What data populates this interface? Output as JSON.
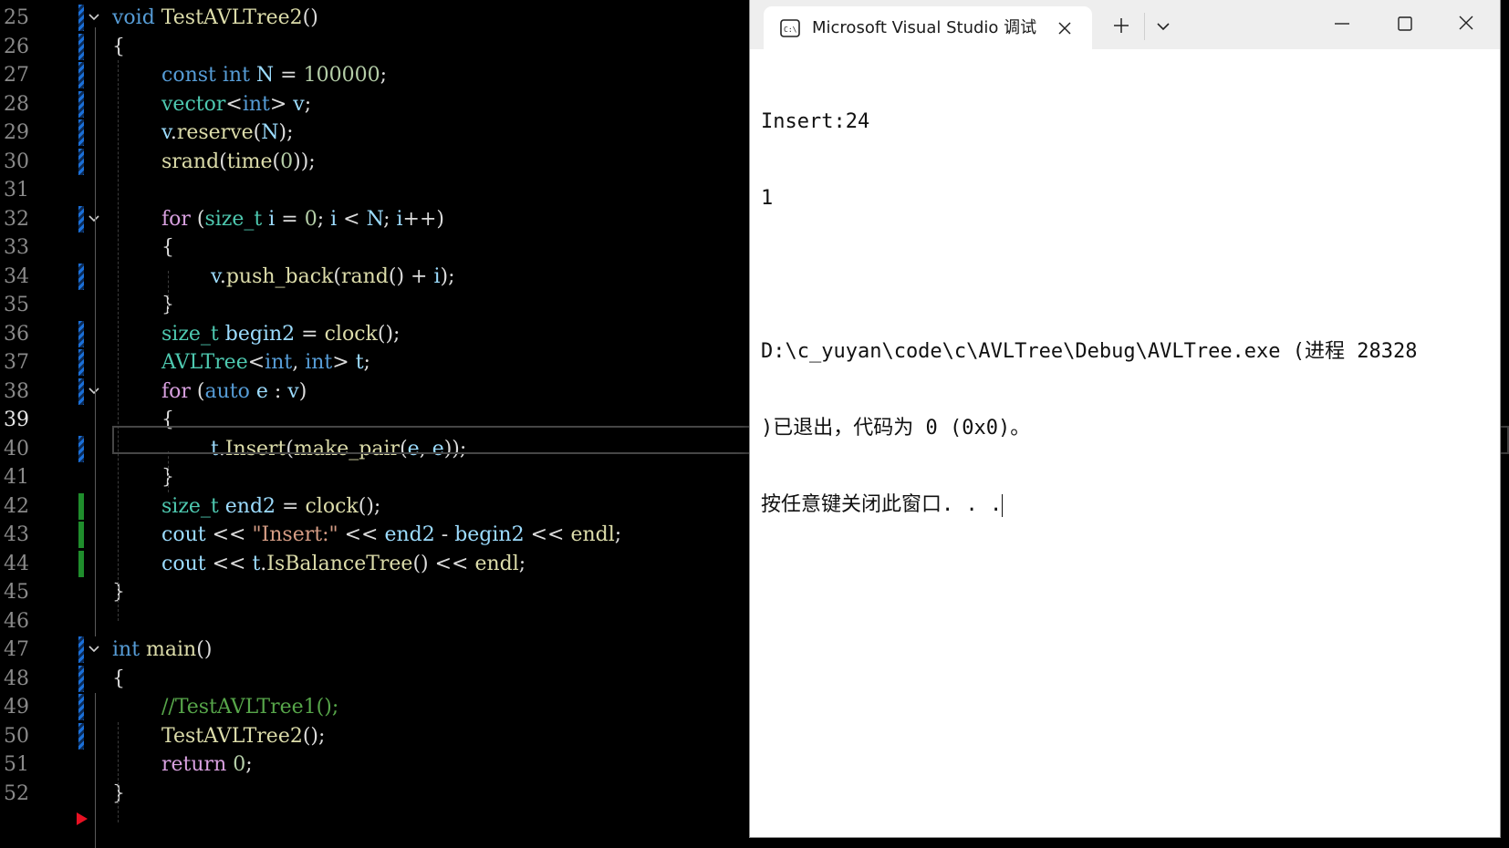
{
  "editor": {
    "current_line": 39,
    "lines": [
      {
        "n": 25,
        "tokens": [
          {
            "c": "kw",
            "t": "void"
          },
          {
            "c": "pl",
            "t": " "
          },
          {
            "c": "fn",
            "t": "TestAVLTree2"
          },
          {
            "c": "pl",
            "t": "()"
          }
        ]
      },
      {
        "n": 26,
        "tokens": [
          {
            "c": "pl",
            "t": "{"
          }
        ]
      },
      {
        "n": 27,
        "tokens": [
          {
            "c": "kw",
            "t": "const"
          },
          {
            "c": "pl",
            "t": " "
          },
          {
            "c": "kw",
            "t": "int"
          },
          {
            "c": "pl",
            "t": " "
          },
          {
            "c": "var",
            "t": "N"
          },
          {
            "c": "pl",
            "t": " = "
          },
          {
            "c": "num",
            "t": "100000"
          },
          {
            "c": "pl",
            "t": ";"
          }
        ]
      },
      {
        "n": 28,
        "tokens": [
          {
            "c": "ty",
            "t": "vector"
          },
          {
            "c": "pl",
            "t": "<"
          },
          {
            "c": "kw",
            "t": "int"
          },
          {
            "c": "pl",
            "t": "> "
          },
          {
            "c": "var",
            "t": "v"
          },
          {
            "c": "pl",
            "t": ";"
          }
        ]
      },
      {
        "n": 29,
        "tokens": [
          {
            "c": "var",
            "t": "v"
          },
          {
            "c": "pl",
            "t": "."
          },
          {
            "c": "fn",
            "t": "reserve"
          },
          {
            "c": "pl",
            "t": "("
          },
          {
            "c": "var",
            "t": "N"
          },
          {
            "c": "pl",
            "t": ");"
          }
        ]
      },
      {
        "n": 30,
        "tokens": [
          {
            "c": "fn",
            "t": "srand"
          },
          {
            "c": "pl",
            "t": "("
          },
          {
            "c": "fn",
            "t": "time"
          },
          {
            "c": "pl",
            "t": "("
          },
          {
            "c": "num",
            "t": "0"
          },
          {
            "c": "pl",
            "t": "));"
          }
        ]
      },
      {
        "n": 31,
        "tokens": []
      },
      {
        "n": 32,
        "tokens": [
          {
            "c": "ctl",
            "t": "for"
          },
          {
            "c": "pl",
            "t": " ("
          },
          {
            "c": "ty",
            "t": "size_t"
          },
          {
            "c": "pl",
            "t": " "
          },
          {
            "c": "var",
            "t": "i"
          },
          {
            "c": "pl",
            "t": " = "
          },
          {
            "c": "num",
            "t": "0"
          },
          {
            "c": "pl",
            "t": "; "
          },
          {
            "c": "var",
            "t": "i"
          },
          {
            "c": "pl",
            "t": " < "
          },
          {
            "c": "var",
            "t": "N"
          },
          {
            "c": "pl",
            "t": "; "
          },
          {
            "c": "var",
            "t": "i"
          },
          {
            "c": "pl",
            "t": "++)"
          }
        ]
      },
      {
        "n": 33,
        "tokens": [
          {
            "c": "pl",
            "t": "{"
          }
        ]
      },
      {
        "n": 34,
        "tokens": [
          {
            "c": "var",
            "t": "v"
          },
          {
            "c": "pl",
            "t": "."
          },
          {
            "c": "fn",
            "t": "push_back"
          },
          {
            "c": "pl",
            "t": "("
          },
          {
            "c": "fn",
            "t": "rand"
          },
          {
            "c": "pl",
            "t": "() + "
          },
          {
            "c": "var",
            "t": "i"
          },
          {
            "c": "pl",
            "t": ");"
          }
        ]
      },
      {
        "n": 35,
        "tokens": [
          {
            "c": "pl",
            "t": "}"
          }
        ]
      },
      {
        "n": 36,
        "tokens": [
          {
            "c": "ty",
            "t": "size_t"
          },
          {
            "c": "pl",
            "t": " "
          },
          {
            "c": "var",
            "t": "begin2"
          },
          {
            "c": "pl",
            "t": " = "
          },
          {
            "c": "fn",
            "t": "clock"
          },
          {
            "c": "pl",
            "t": "();"
          }
        ]
      },
      {
        "n": 37,
        "tokens": [
          {
            "c": "ty",
            "t": "AVLTree"
          },
          {
            "c": "pl",
            "t": "<"
          },
          {
            "c": "kw",
            "t": "int"
          },
          {
            "c": "pl",
            "t": ", "
          },
          {
            "c": "kw",
            "t": "int"
          },
          {
            "c": "pl",
            "t": "> "
          },
          {
            "c": "var",
            "t": "t"
          },
          {
            "c": "pl",
            "t": ";"
          }
        ]
      },
      {
        "n": 38,
        "tokens": [
          {
            "c": "ctl",
            "t": "for"
          },
          {
            "c": "pl",
            "t": " ("
          },
          {
            "c": "kw",
            "t": "auto"
          },
          {
            "c": "pl",
            "t": " "
          },
          {
            "c": "var",
            "t": "e"
          },
          {
            "c": "pl",
            "t": " : "
          },
          {
            "c": "var",
            "t": "v"
          },
          {
            "c": "pl",
            "t": ")"
          }
        ]
      },
      {
        "n": 39,
        "tokens": [
          {
            "c": "pl",
            "t": "{"
          }
        ]
      },
      {
        "n": 40,
        "tokens": [
          {
            "c": "var",
            "t": "t"
          },
          {
            "c": "pl",
            "t": "."
          },
          {
            "c": "fn",
            "t": "Insert"
          },
          {
            "c": "pl",
            "t": "("
          },
          {
            "c": "fn",
            "t": "make_pair"
          },
          {
            "c": "pl",
            "t": "("
          },
          {
            "c": "var",
            "t": "e"
          },
          {
            "c": "pl",
            "t": ", "
          },
          {
            "c": "var",
            "t": "e"
          },
          {
            "c": "pl",
            "t": "));"
          }
        ]
      },
      {
        "n": 41,
        "tokens": [
          {
            "c": "pl",
            "t": "}"
          }
        ]
      },
      {
        "n": 42,
        "tokens": [
          {
            "c": "ty",
            "t": "size_t"
          },
          {
            "c": "pl",
            "t": " "
          },
          {
            "c": "var",
            "t": "end2"
          },
          {
            "c": "pl",
            "t": " = "
          },
          {
            "c": "fn",
            "t": "clock"
          },
          {
            "c": "pl",
            "t": "();"
          }
        ]
      },
      {
        "n": 43,
        "tokens": [
          {
            "c": "var",
            "t": "cout"
          },
          {
            "c": "pl",
            "t": " << "
          },
          {
            "c": "str",
            "t": "\"Insert:\""
          },
          {
            "c": "pl",
            "t": " << "
          },
          {
            "c": "var",
            "t": "end2"
          },
          {
            "c": "pl",
            "t": " - "
          },
          {
            "c": "var",
            "t": "begin2"
          },
          {
            "c": "pl",
            "t": " << "
          },
          {
            "c": "fn",
            "t": "endl"
          },
          {
            "c": "pl",
            "t": ";"
          }
        ]
      },
      {
        "n": 44,
        "tokens": [
          {
            "c": "var",
            "t": "cout"
          },
          {
            "c": "pl",
            "t": " << "
          },
          {
            "c": "var",
            "t": "t"
          },
          {
            "c": "pl",
            "t": "."
          },
          {
            "c": "fn",
            "t": "IsBalanceTree"
          },
          {
            "c": "pl",
            "t": "() << "
          },
          {
            "c": "fn",
            "t": "endl"
          },
          {
            "c": "pl",
            "t": ";"
          }
        ]
      },
      {
        "n": 45,
        "tokens": [
          {
            "c": "pl",
            "t": "}"
          }
        ]
      },
      {
        "n": 46,
        "tokens": []
      },
      {
        "n": 47,
        "tokens": [
          {
            "c": "kw",
            "t": "int"
          },
          {
            "c": "pl",
            "t": " "
          },
          {
            "c": "fn",
            "t": "main"
          },
          {
            "c": "pl",
            "t": "()"
          }
        ]
      },
      {
        "n": 48,
        "tokens": [
          {
            "c": "pl",
            "t": "{"
          }
        ]
      },
      {
        "n": 49,
        "tokens": [
          {
            "c": "cmt",
            "t": "//TestAVLTree1();"
          }
        ]
      },
      {
        "n": 50,
        "tokens": [
          {
            "c": "fn",
            "t": "TestAVLTree2"
          },
          {
            "c": "pl",
            "t": "();"
          }
        ]
      },
      {
        "n": 51,
        "tokens": [
          {
            "c": "ctl",
            "t": "return"
          },
          {
            "c": "pl",
            "t": " "
          },
          {
            "c": "num",
            "t": "0"
          },
          {
            "c": "pl",
            "t": ";"
          }
        ]
      },
      {
        "n": 52,
        "tokens": [
          {
            "c": "pl",
            "t": "}"
          }
        ]
      }
    ]
  },
  "console": {
    "tab_title": "Microsoft Visual Studio 调试控制台",
    "icon": "console-app-icon",
    "output_lines": [
      "Insert:24",
      "1",
      "",
      "D:\\c_yuyan\\code\\c\\AVLTree\\Debug\\AVLTree.exe (进程 28328",
      ")已退出，代码为 0 (0x0)。",
      "按任意键关闭此窗口. . ."
    ]
  },
  "colors": {
    "keyword": "#569cd6",
    "type": "#4ec9b0",
    "function": "#dcdcaa",
    "variable": "#9cdcfe",
    "number": "#b5cea8",
    "string": "#d69d85",
    "comment": "#57a64a",
    "control": "#d8a0df",
    "change_saved": "#1f8d2c",
    "change_unsaved": "#1a6fd8",
    "breakpoint_arrow": "#e81123"
  }
}
